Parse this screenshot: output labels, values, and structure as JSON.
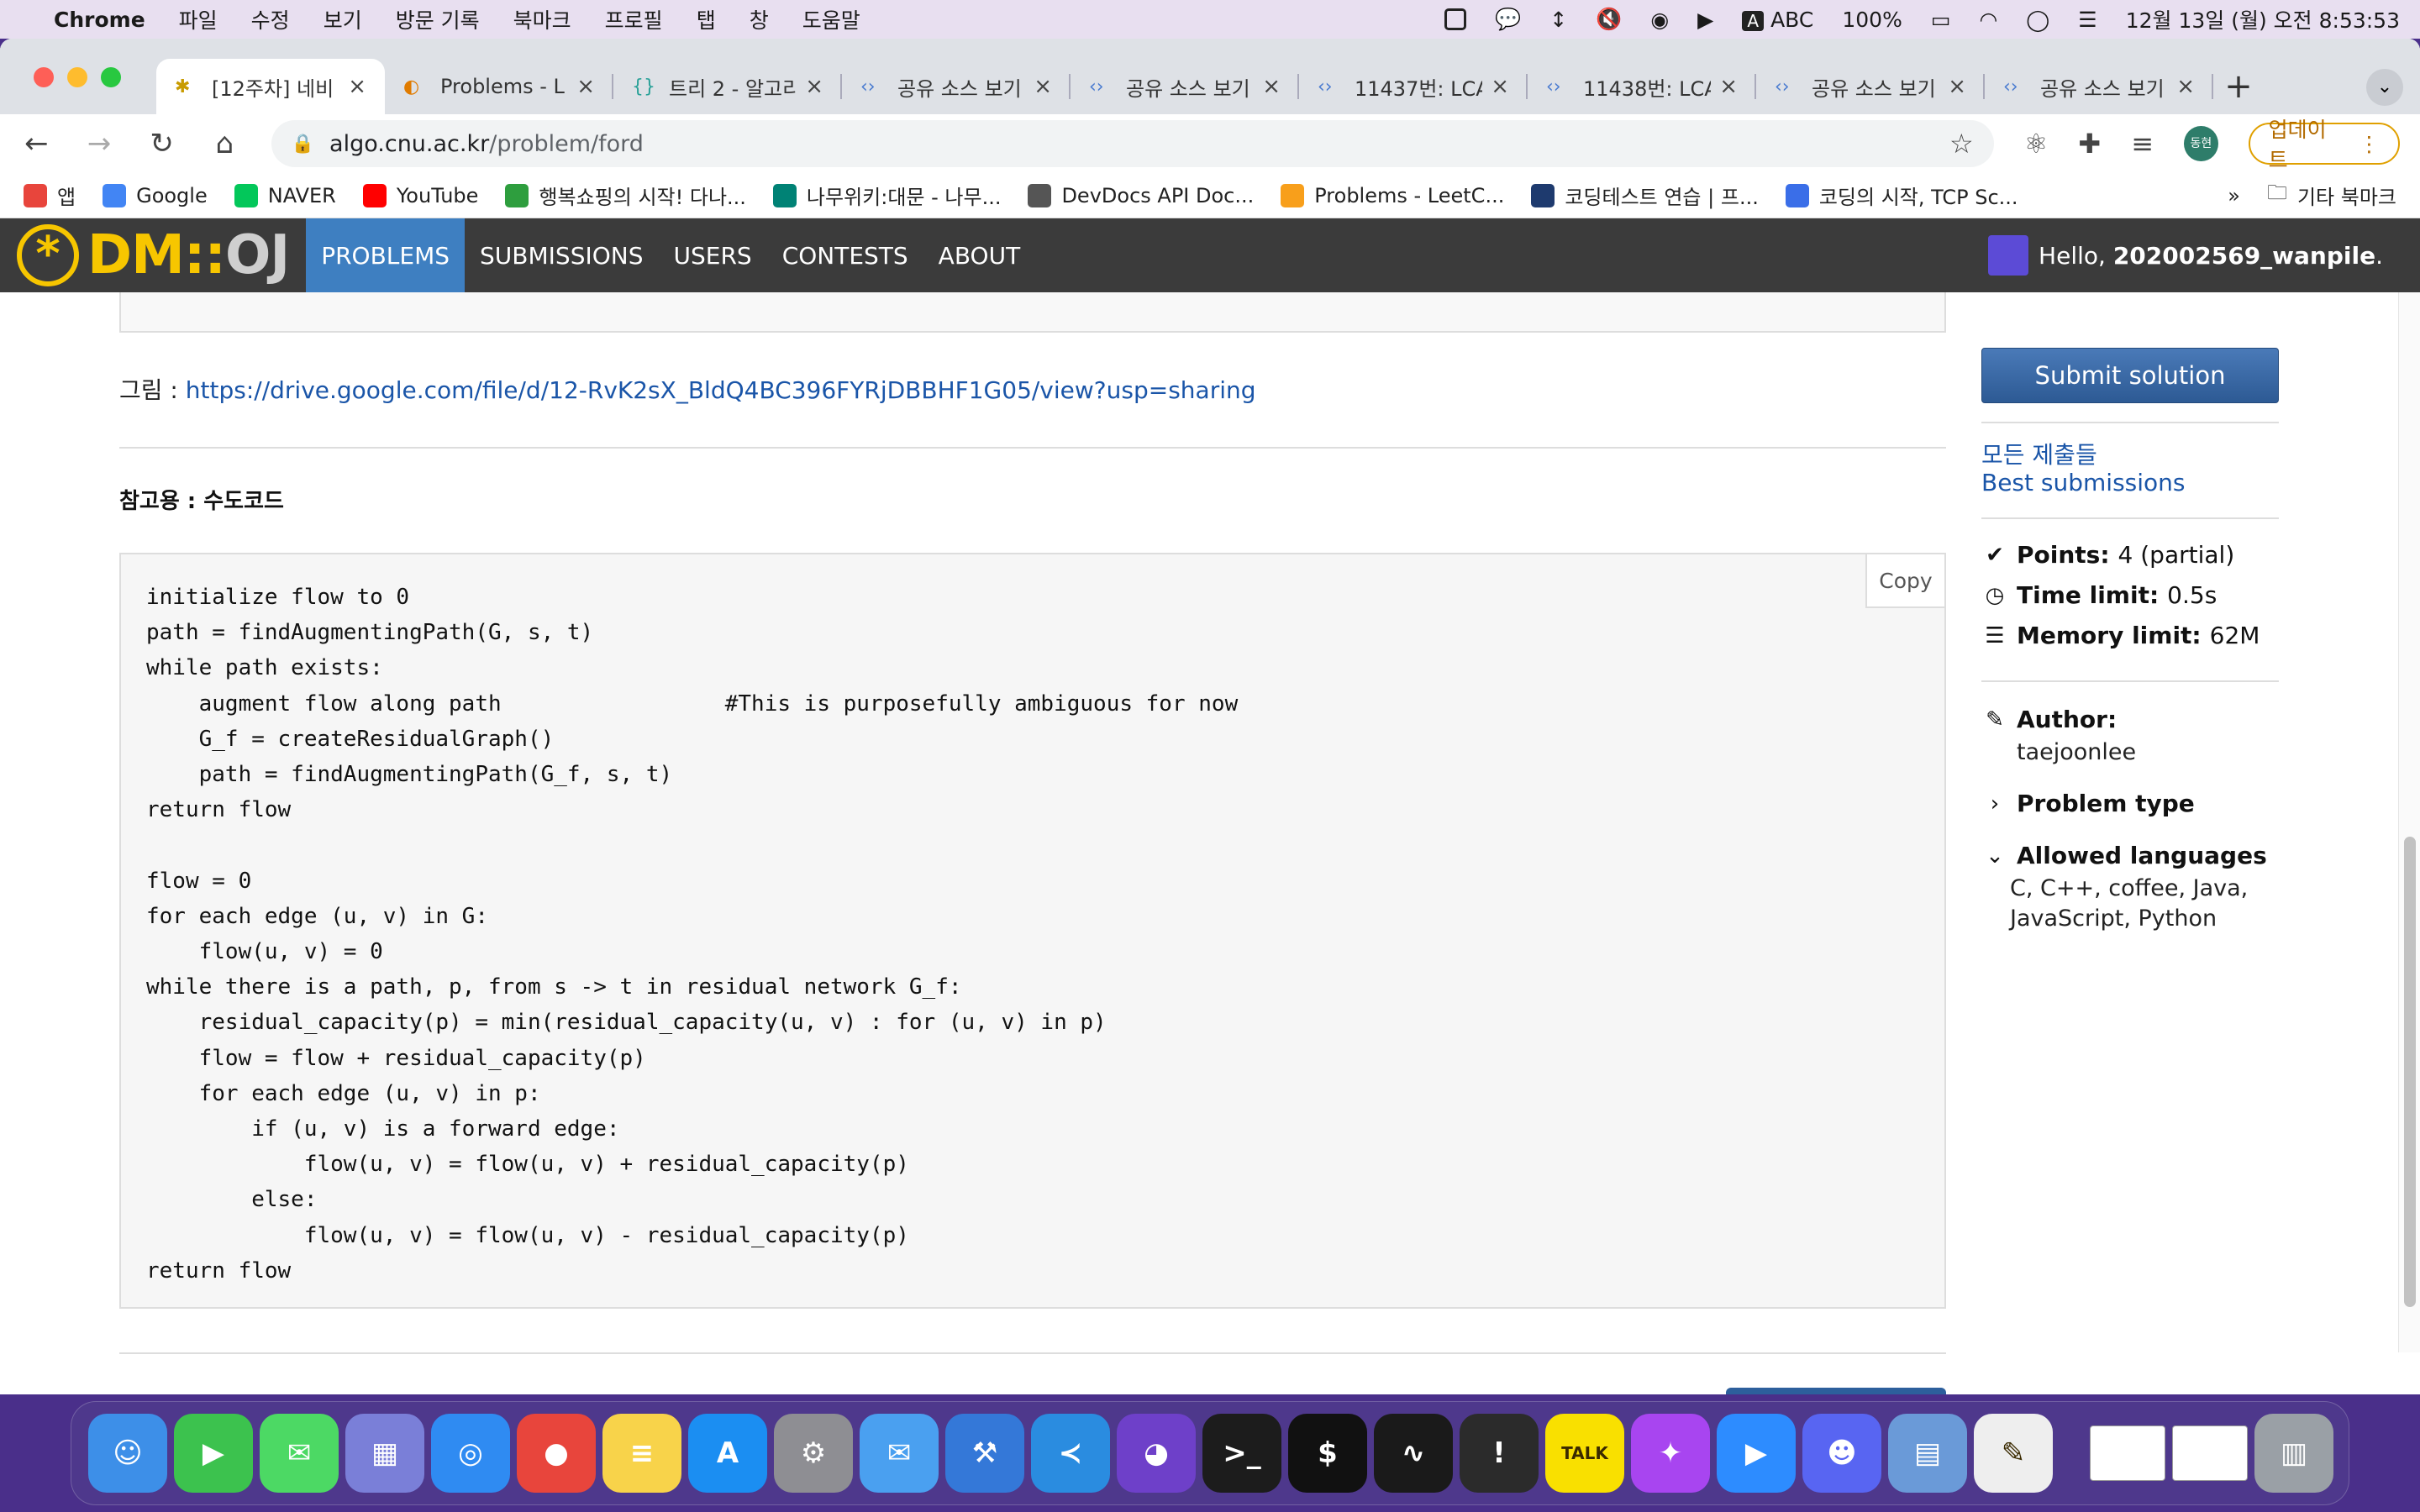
{
  "menubar": {
    "app": "Chrome",
    "items": [
      "파일",
      "수정",
      "보기",
      "방문 기록",
      "북마크",
      "프로필",
      "탭",
      "창",
      "도움말"
    ],
    "input_source": "ABC",
    "battery": "100%",
    "clock": "12월 13일 (월) 오전 8:53:53"
  },
  "tabs": [
    {
      "title": "[12주차] 네비",
      "icon": "dmoj-icon",
      "active": true
    },
    {
      "title": "Problems - L",
      "icon": "leetcode-icon",
      "active": false
    },
    {
      "title": "트리 2 - 알고리",
      "icon": "braces-icon",
      "active": false
    },
    {
      "title": "공유 소스 보기",
      "icon": "code-icon",
      "active": false
    },
    {
      "title": "공유 소스 보기",
      "icon": "code-icon",
      "active": false
    },
    {
      "title": "11437번: LCA",
      "icon": "code-icon",
      "active": false
    },
    {
      "title": "11438번: LCA",
      "icon": "code-icon",
      "active": false
    },
    {
      "title": "공유 소스 보기",
      "icon": "code-icon",
      "active": false
    },
    {
      "title": "공유 소스 보기",
      "icon": "code-icon",
      "active": false
    }
  ],
  "address": {
    "host": "algo.cnu.ac.kr",
    "path": "/problem/ford"
  },
  "profile_badge": "동현",
  "update_label": "업데이트",
  "bookmarks": [
    {
      "label": "앱",
      "color": "#e8453c"
    },
    {
      "label": "Google",
      "color": "#4285f4"
    },
    {
      "label": "NAVER",
      "color": "#03c75a"
    },
    {
      "label": "YouTube",
      "color": "#ff0000"
    },
    {
      "label": "행복쇼핑의 시작! 다나...",
      "color": "#2e9e3e"
    },
    {
      "label": "나무위키:대문 - 나무...",
      "color": "#008275"
    },
    {
      "label": "DevDocs API Doc...",
      "color": "#555555"
    },
    {
      "label": "Problems - LeetC...",
      "color": "#f89f1b"
    },
    {
      "label": "코딩테스트 연습 | 프...",
      "color": "#1e3a6e"
    },
    {
      "label": "코딩의 시작, TCP Sc...",
      "color": "#3a6ee8"
    }
  ],
  "bookmarks_other": "기타 북마크",
  "site": {
    "logo_main": "DM::",
    "logo_oj": "OJ",
    "nav": [
      "PROBLEMS",
      "SUBMISSIONS",
      "USERS",
      "CONTESTS",
      "ABOUT"
    ],
    "hello_prefix": "Hello, ",
    "username": "202002569_wanpile",
    "hello_suffix": "."
  },
  "problem": {
    "figure_label": "그림 : ",
    "figure_url": "https://drive.google.com/file/d/12-RvK2sX_BldQ4BC396FYRjDBBHF1G05/view?usp=sharing",
    "ref_heading": "참고용 : 수도코드",
    "copy_label": "Copy",
    "code": "initialize flow to 0\npath = findAugmentingPath(G, s, t)\nwhile path exists:\n    augment flow along path                 #This is purposefully ambiguous for now\n    G_f = createResidualGraph()\n    path = findAugmentingPath(G_f, s, t)\nreturn flow\n\nflow = 0\nfor each edge (u, v) in G:\n    flow(u, v) = 0\nwhile there is a path, p, from s -> t in residual network G_f:\n    residual_capacity(p) = min(residual_capacity(u, v) : for (u, v) in p)\n    flow = flow + residual_capacity(p)\n    for each edge (u, v) in p:\n        if (u, v) is a forward edge:\n            flow(u, v) = flow(u, v) + residual_capacity(p)\n        else:\n            flow(u, v) = flow(u, v) - residual_capacity(p)\nreturn flow"
  },
  "sidebar": {
    "submit": "Submit solution",
    "all_submissions": "모든 제출들",
    "best_submissions": "Best submissions",
    "points_label": "Points:",
    "points_value": "4 (partial)",
    "time_label": "Time limit:",
    "time_value": "0.5s",
    "memory_label": "Memory limit:",
    "memory_value": "62M",
    "author_label": "Author:",
    "author_value": "taejoonlee",
    "problem_type_label": "Problem type",
    "languages_label": "Allowed languages",
    "languages_value": "C, C++, coffee, Java, JavaScript, Python"
  },
  "dock": [
    {
      "name": "finder-icon",
      "color": "#3d8fe8",
      "glyph": "☺"
    },
    {
      "name": "facetime-icon",
      "color": "#3cc24e",
      "glyph": "▶"
    },
    {
      "name": "messages-icon",
      "color": "#4cd964",
      "glyph": "✉"
    },
    {
      "name": "launchpad-icon",
      "color": "#7a7fd8",
      "glyph": "▦"
    },
    {
      "name": "safari-icon",
      "color": "#2f8bf2",
      "glyph": "◎"
    },
    {
      "name": "chrome-icon",
      "color": "#e8453c",
      "glyph": "●"
    },
    {
      "name": "notes-icon",
      "color": "#f8d34a",
      "glyph": "≡"
    },
    {
      "name": "appstore-icon",
      "color": "#1b8ef2",
      "glyph": "A"
    },
    {
      "name": "settings-icon",
      "color": "#8e8e93",
      "glyph": "⚙"
    },
    {
      "name": "mail-icon",
      "color": "#4aa0f0",
      "glyph": "✉"
    },
    {
      "name": "xcode-icon",
      "color": "#3478d8",
      "glyph": "⚒"
    },
    {
      "name": "vscode-icon",
      "color": "#2a8ce0",
      "glyph": "≺"
    },
    {
      "name": "github-icon",
      "color": "#6e40c9",
      "glyph": "◕"
    },
    {
      "name": "terminal-icon",
      "color": "#1c1c1c",
      "glyph": ">_"
    },
    {
      "name": "iterm-icon",
      "color": "#111111",
      "glyph": "$"
    },
    {
      "name": "activity-monitor-icon",
      "color": "#1a1a1a",
      "glyph": "∿"
    },
    {
      "name": "console-icon",
      "color": "#2b2b2b",
      "glyph": "!"
    },
    {
      "name": "kakaotalk-icon",
      "color": "#f9e000",
      "glyph": "TALK"
    },
    {
      "name": "messenger-icon",
      "color": "#a845f0",
      "glyph": "✦"
    },
    {
      "name": "zoom-icon",
      "color": "#2d8cff",
      "glyph": "▶"
    },
    {
      "name": "discord-icon",
      "color": "#5865f2",
      "glyph": "☻"
    },
    {
      "name": "preview-icon",
      "color": "#6a9ad8",
      "glyph": "▤"
    },
    {
      "name": "textedit-icon",
      "color": "#eeeeee",
      "glyph": "✎"
    },
    {
      "name": "window-thumb-1",
      "color": "#ffffff",
      "glyph": ""
    },
    {
      "name": "window-thumb-2",
      "color": "#ffffff",
      "glyph": ""
    },
    {
      "name": "trash-icon",
      "color": "#9aa0a6",
      "glyph": "▥"
    }
  ]
}
